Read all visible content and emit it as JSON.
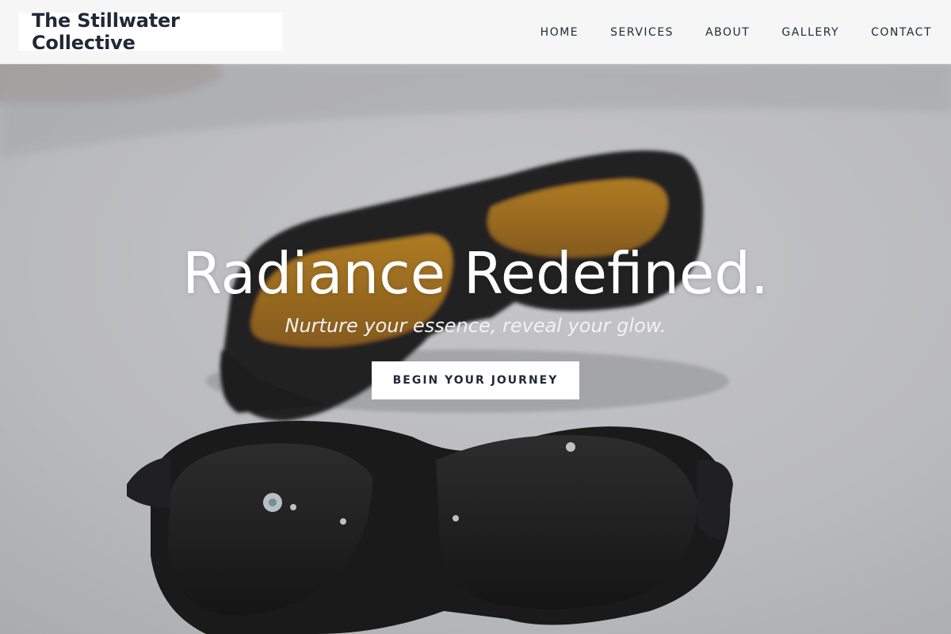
{
  "header": {
    "brand": "The Stillwater Collective",
    "nav": [
      "HOME",
      "SERVICES",
      "ABOUT",
      "GALLERY",
      "CONTACT"
    ]
  },
  "hero": {
    "title": "Radiance Redefined.",
    "subtitle": "Nurture your essence, reveal your glow.",
    "cta_label": "BEGIN YOUR JOURNEY",
    "image_subject": "two pairs of protective laser goggles (amber-tinted and dark) on a white surface"
  },
  "colors": {
    "header_bg": "#f6f6f6",
    "text_dark": "#1f2937",
    "hero_text": "#ffffff",
    "lens_amber": "#c98a1d"
  }
}
